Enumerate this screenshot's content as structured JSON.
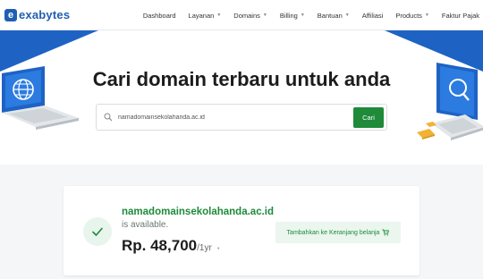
{
  "brand": {
    "logo_letter": "e",
    "name": "exabytes"
  },
  "nav": {
    "items": [
      {
        "label": "Dashboard",
        "dropdown": false
      },
      {
        "label": "Layanan",
        "dropdown": true
      },
      {
        "label": "Domains",
        "dropdown": true
      },
      {
        "label": "Billing",
        "dropdown": true
      },
      {
        "label": "Bantuan",
        "dropdown": true
      },
      {
        "label": "Affiliasi",
        "dropdown": false
      },
      {
        "label": "Products",
        "dropdown": true
      },
      {
        "label": "Faktur Pajak",
        "dropdown": false
      }
    ]
  },
  "hero": {
    "title": "Cari domain terbaru untuk anda",
    "search_value": "namadomainsekolahanda.ac.id",
    "search_button": "Cari"
  },
  "result": {
    "domain": "namadomainsekolahanda.ac.id",
    "status": "is available.",
    "price": "Rp. 48,700",
    "period": "/1yr",
    "add_to_cart": "Tambahkan ke Keranjang belanja"
  },
  "colors": {
    "brand_blue": "#1f5fb3",
    "accent_blue": "#1e63c4",
    "success_green": "#1e8a3a"
  },
  "icons": [
    "search-icon",
    "check-icon",
    "cart-icon",
    "laptop-globe-icon",
    "laptop-search-icon"
  ]
}
